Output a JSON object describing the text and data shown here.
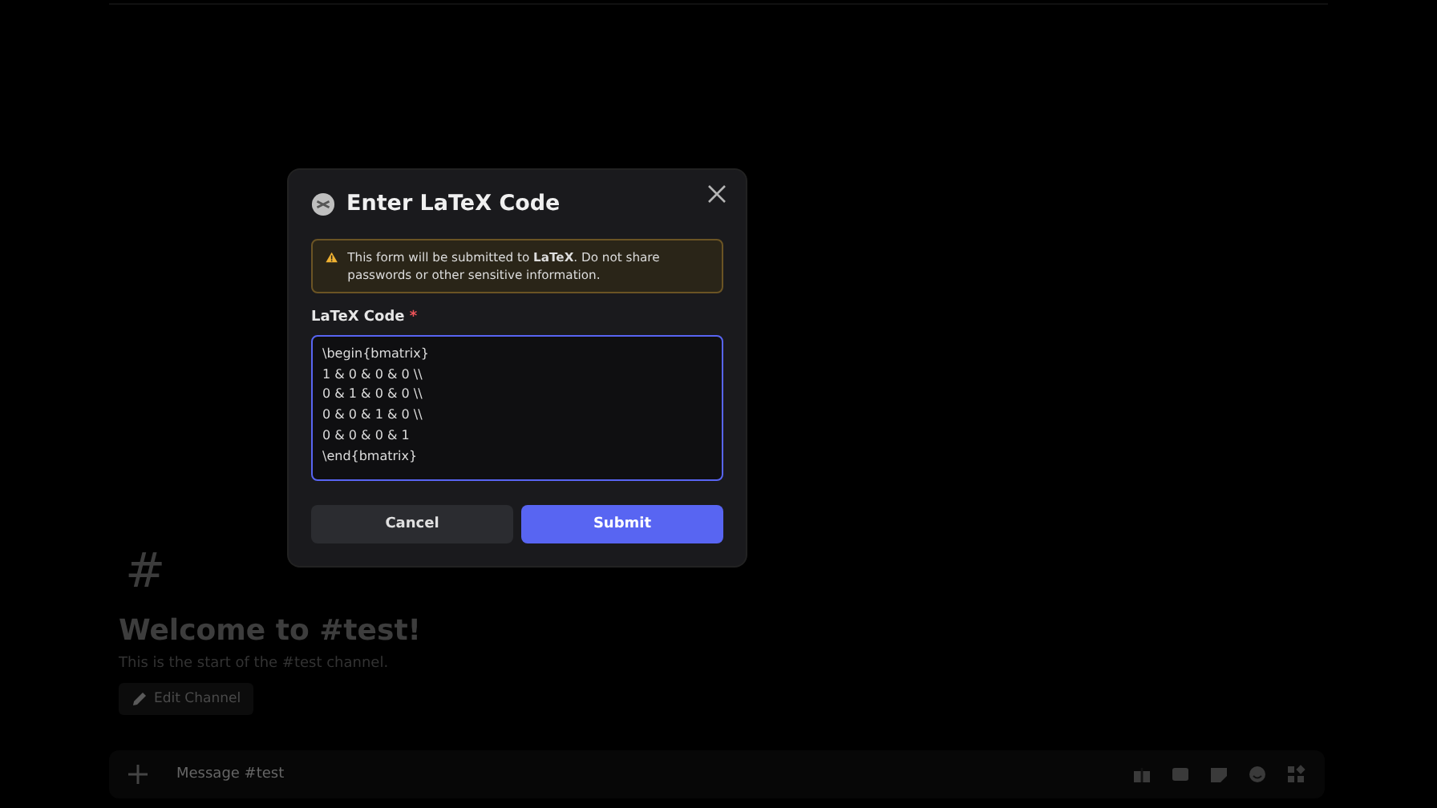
{
  "channel": {
    "hash": "#",
    "title": "Welcome to #test!",
    "subtitle": "This is the start of the #test channel.",
    "edit_button": "Edit Channel"
  },
  "message_bar": {
    "placeholder": "Message #test"
  },
  "modal": {
    "title": "Enter LaTeX Code",
    "warning": "This form will be submitted to **LaTeX**. Do not share passwords or other sensitive information.",
    "field_label": "LaTeX Code",
    "required_mark": "*",
    "code_lines": [
      "\\begin{bmatrix}",
      "1 & 0 & 0 & 0 \\\\",
      "0 & 1 & 0 & 0 \\\\",
      "0 & 0 & 1 & 0 \\\\",
      "0 & 0 & 0 & 1",
      "\\end{bmatrix}"
    ],
    "buttons": [
      {
        "label": "Cancel",
        "kind": "secondary"
      },
      {
        "label": "Submit",
        "kind": "primary"
      }
    ]
  }
}
